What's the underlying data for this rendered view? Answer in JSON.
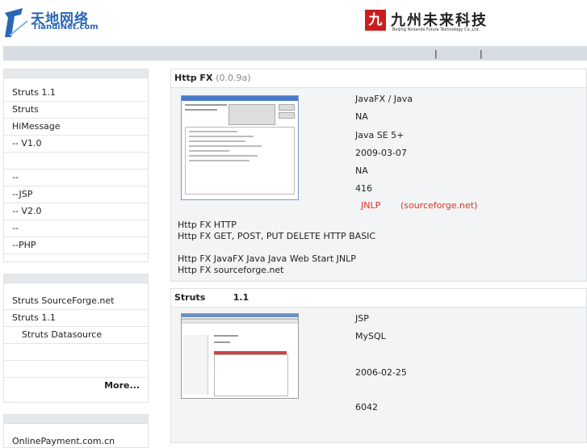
{
  "header": {
    "logo_left": {
      "cn": "天地网络",
      "en": "TiandiNet.com"
    },
    "logo_right": {
      "cn": "九州未来科技",
      "en": "Beijing Ninlands Future Technology Co.,Ltd."
    },
    "nav_separators": [
      "|",
      "|"
    ]
  },
  "sidebar": {
    "box1": [
      "Struts   1.1",
      "Struts",
      "HiMessage",
      "--   V1.0",
      "",
      "--",
      "--JSP",
      "--  V2.0",
      "--",
      "--PHP"
    ],
    "box2": [
      "Struts    SourceForge.net",
      "Struts   1.1",
      "Struts    Datasource",
      "",
      ""
    ],
    "box2_more": "More...",
    "box3_text": "OnlinePayment.com.cn"
  },
  "panel1": {
    "title": "Http FX",
    "version": "(0.0.9a)",
    "info": [
      "JavaFX / Java",
      "NA",
      "Java SE 5+",
      "2009-03-07",
      "NA",
      "416"
    ],
    "links": {
      "jnlp": "JNLP",
      "sf": "(sourceforge.net)"
    },
    "desc": [
      "Http FX   HTTP",
      "Http FX    GET, POST, PUT DELETE      HTTP BASIC",
      "",
      "Http FX  JavaFX Java     Java Web Start     JNLP",
      "    Http FX sourceforge.net"
    ]
  },
  "panel2": {
    "title": "Struts         1.1",
    "info": [
      "JSP",
      "MySQL",
      "",
      "2006-02-25",
      "",
      "6042"
    ]
  },
  "colors": {
    "accent_red": "#d32222",
    "nav_bg": "#d7dde2",
    "panel_bg": "#f2f4f5",
    "logo_blue": "#2a67b4"
  }
}
